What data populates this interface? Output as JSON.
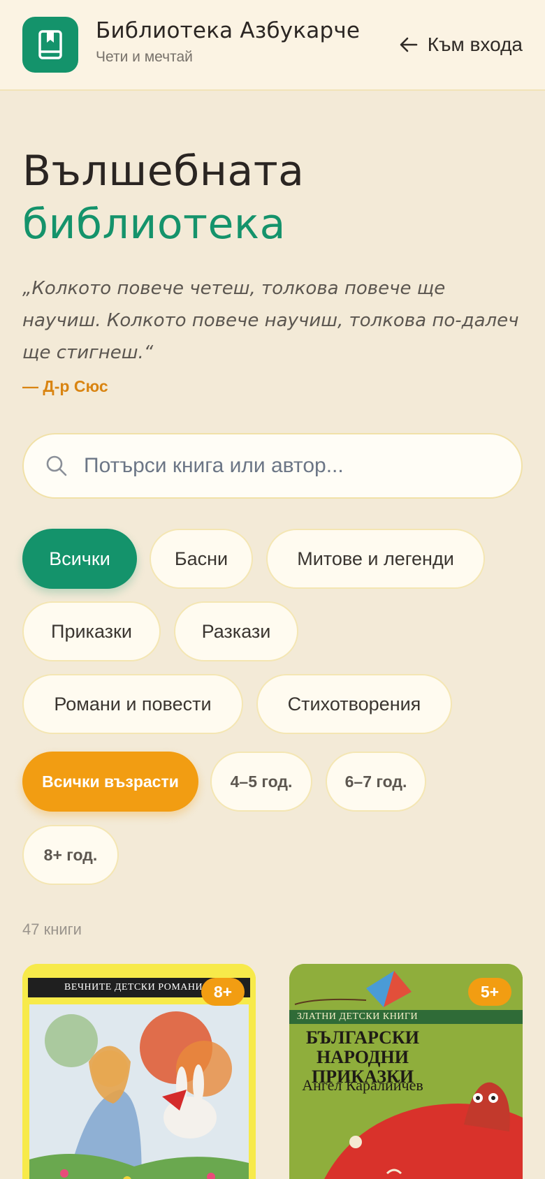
{
  "header": {
    "title": "Библиотека Азбукарче",
    "subtitle": "Чети и мечтай",
    "back_label": "Към входа",
    "brand_color": "#14936b"
  },
  "hero": {
    "title_line1": "Вълшебната",
    "title_line2": "библиотека",
    "quote": "„Колкото повече четеш, толкова повече ще научиш. Колкото повече научиш, толкова по-далеч ще стигнеш.“",
    "quote_author": "— Д-р Сюс"
  },
  "search": {
    "placeholder": "Потърси книга или автор...",
    "value": ""
  },
  "genres": [
    {
      "label": "Всички",
      "selected": true
    },
    {
      "label": "Басни",
      "selected": false
    },
    {
      "label": "Митове и легенди",
      "selected": false
    },
    {
      "label": "Приказки",
      "selected": false
    },
    {
      "label": "Разкази",
      "selected": false
    },
    {
      "label": "Романи и повести",
      "selected": false
    },
    {
      "label": "Стихотворения",
      "selected": false
    }
  ],
  "ages": [
    {
      "label": "Всички възрасти",
      "selected": true
    },
    {
      "label": "4–5 год.",
      "selected": false
    },
    {
      "label": "6–7 год.",
      "selected": false
    },
    {
      "label": "8+ год.",
      "selected": false
    }
  ],
  "book_count": "47 книги",
  "books": [
    {
      "age_badge": "8+",
      "cover_series": "ВЕЧНИТЕ ДЕТСКИ РОМАНИ",
      "cover_color": "#f7ea4a"
    },
    {
      "age_badge": "5+",
      "cover_series": "ЗЛАТНИ ДЕТСКИ КНИГИ",
      "cover_title": "БЪЛГАРСКИ НАРОДНИ ПРИКАЗКИ",
      "cover_author": "Ангел Каралийчев",
      "cover_color": "#8fae3c"
    }
  ]
}
